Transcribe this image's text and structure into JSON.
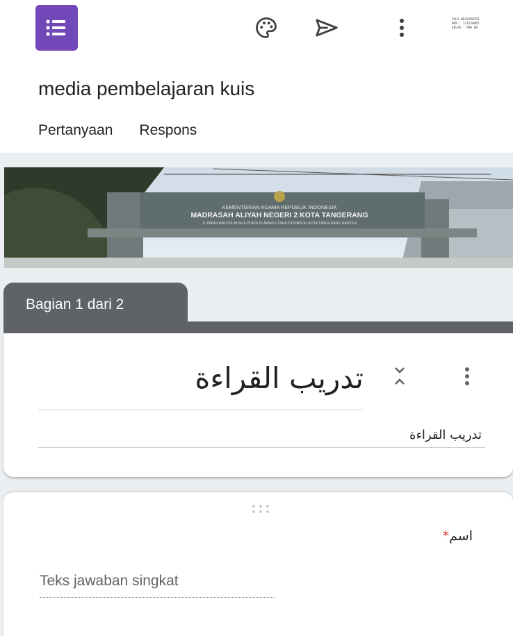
{
  "app": {
    "logo_icon": "google-forms-icon",
    "accent_color": "#7248b9",
    "toolbar": {
      "palette_icon": "palette-icon",
      "send_icon": "send-icon",
      "more_icon": "more-vert-icon"
    },
    "profile_lines": [
      "YOLI WEISAPUTRI",
      "NIM : 171220055",
      "KELAS : PBA 6B"
    ]
  },
  "form": {
    "title": "media pembelajaran kuis",
    "tabs": [
      "Pertanyaan",
      "Respons"
    ]
  },
  "banner": {
    "lines": [
      "KEMENTERIAN AGAMA REPUBLIK INDONESIA",
      "MADRASAH ALIYAH NEGERI 2 KOTA TANGERANG",
      "Jl. PANGLIMA POLIM No.6 PORIS PLAWAD UTARA CIPONDOH KOTA TANGERANG BANTEN"
    ]
  },
  "section": {
    "label": "Bagian 1 dari 2",
    "title": "تدريب القراءة",
    "description": "تدريب القراءة",
    "color": "#5f6368"
  },
  "question": {
    "title": "اسم",
    "required_mark": "*",
    "answer_placeholder": "Teks jawaban singkat"
  }
}
